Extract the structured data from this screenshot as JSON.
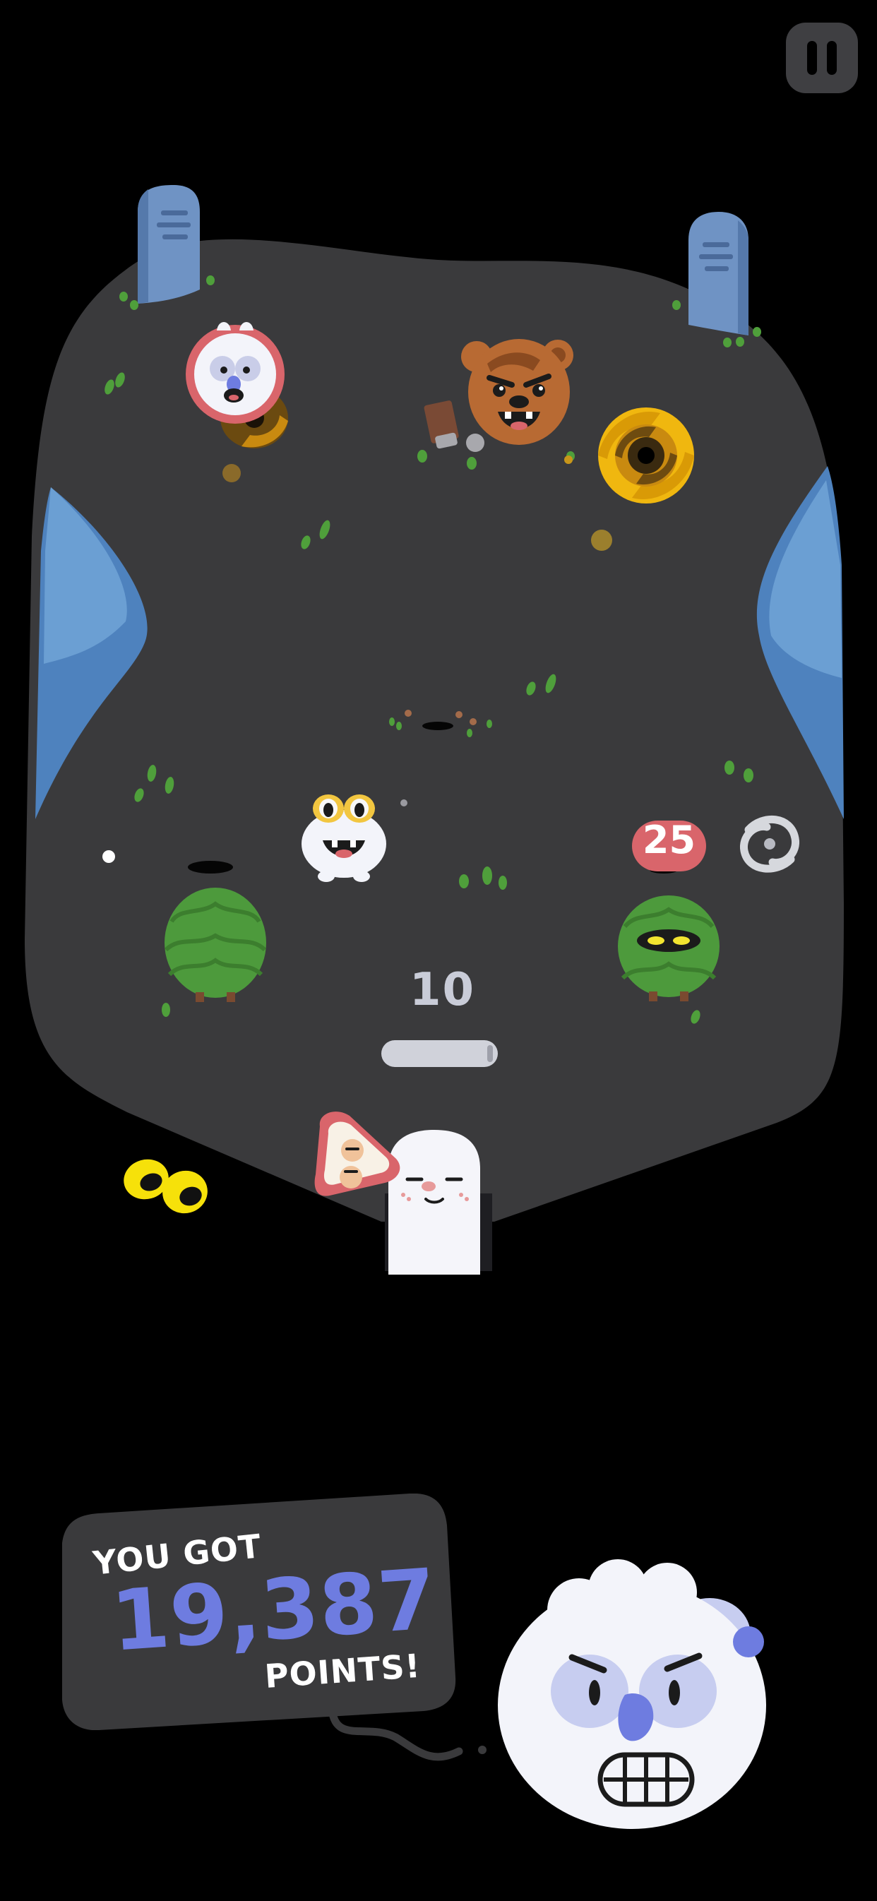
{
  "hud": {
    "pause_icon": "pause-icon"
  },
  "board": {
    "ball_counter": "10",
    "bumper_score_popup": "25",
    "characters": [
      "ghost-owl-bumper",
      "bear-bumper",
      "frog-bumper",
      "bush-monster-bumper",
      "ghost-flipper",
      "rabbit-ghost-ball"
    ],
    "hazards": [
      "vortex-hole",
      "vortex-hole",
      "wind-swirl"
    ]
  },
  "result": {
    "line1": "YOU GOT",
    "points": "19,387",
    "line3": "POINTS!"
  },
  "colors": {
    "board": "#3a3a3c",
    "water": "#4e82be",
    "tombstone": "#6f93c4",
    "accent_blue": "#6e7ce0",
    "bush": "#4d9a3c",
    "vortex": "#f0b70f",
    "pink_ring": "#d9656b"
  }
}
